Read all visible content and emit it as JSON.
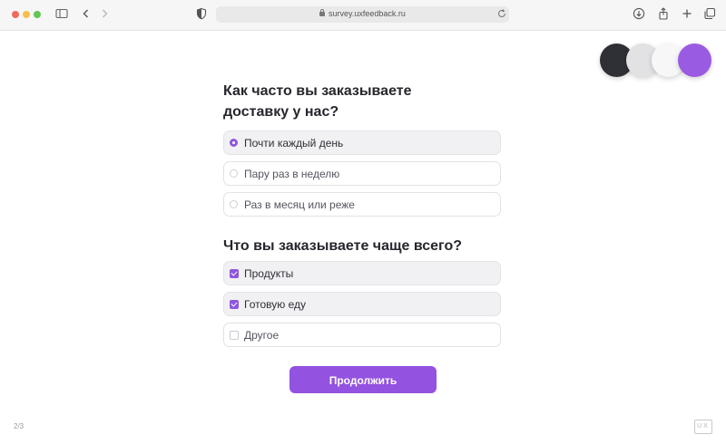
{
  "browser": {
    "url": "survey.uxfeedback.ru"
  },
  "theme_swatches": [
    {
      "name": "dark",
      "color": "#2f3036"
    },
    {
      "name": "gray",
      "color": "#e2e2e5"
    },
    {
      "name": "white",
      "color": "#f7f7f8"
    },
    {
      "name": "purple",
      "color": "#9a5be3"
    }
  ],
  "survey": {
    "q1": {
      "title_line1": "Как часто вы заказываете",
      "title_line2": "доставку у нас?",
      "options": [
        {
          "label": "Почти каждый день",
          "selected": true
        },
        {
          "label": "Пару раз в неделю",
          "selected": false
        },
        {
          "label": "Раз в месяц или реже",
          "selected": false
        }
      ]
    },
    "q2": {
      "title": "Что вы заказываете чаще всего?",
      "options": [
        {
          "label": "Продукты",
          "checked": true
        },
        {
          "label": "Готовую еду",
          "checked": true
        },
        {
          "label": "Другое",
          "checked": false
        }
      ]
    },
    "continue_label": "Продолжить",
    "progress": "2/3"
  },
  "logo_text": "UX",
  "colors": {
    "accent": "#9352e0",
    "selected_bg": "#f1f1f4"
  }
}
